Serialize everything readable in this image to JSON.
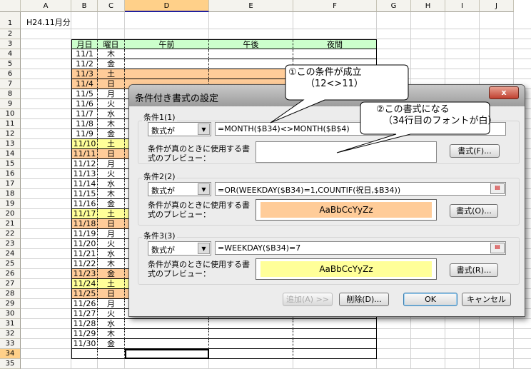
{
  "columns": [
    "A",
    "B",
    "C",
    "D",
    "E",
    "F",
    "G",
    "H",
    "I",
    "J"
  ],
  "selected_column": "D",
  "selected_row": 34,
  "title_cell": "H24.11月分",
  "table_headers": [
    "月日",
    "曜日",
    "午前",
    "午後",
    "夜間"
  ],
  "colors": {
    "header_green": "#CCFFCC",
    "holiday_orange": "#FFCC99",
    "saturday_yellow": "#FFFF99"
  },
  "rows": [
    {
      "date": "11/1",
      "dow": "木",
      "fill": ""
    },
    {
      "date": "11/2",
      "dow": "金",
      "fill": ""
    },
    {
      "date": "11/3",
      "dow": "土",
      "fill": "orange"
    },
    {
      "date": "11/4",
      "dow": "日",
      "fill": "orange"
    },
    {
      "date": "11/5",
      "dow": "月",
      "fill": ""
    },
    {
      "date": "11/6",
      "dow": "火",
      "fill": ""
    },
    {
      "date": "11/7",
      "dow": "水",
      "fill": ""
    },
    {
      "date": "11/8",
      "dow": "木",
      "fill": ""
    },
    {
      "date": "11/9",
      "dow": "金",
      "fill": ""
    },
    {
      "date": "11/10",
      "dow": "土",
      "fill": "yellow"
    },
    {
      "date": "11/11",
      "dow": "日",
      "fill": "orange"
    },
    {
      "date": "11/12",
      "dow": "月",
      "fill": ""
    },
    {
      "date": "11/13",
      "dow": "火",
      "fill": ""
    },
    {
      "date": "11/14",
      "dow": "水",
      "fill": ""
    },
    {
      "date": "11/15",
      "dow": "木",
      "fill": ""
    },
    {
      "date": "11/16",
      "dow": "金",
      "fill": ""
    },
    {
      "date": "11/17",
      "dow": "土",
      "fill": "yellow"
    },
    {
      "date": "11/18",
      "dow": "日",
      "fill": "orange"
    },
    {
      "date": "11/19",
      "dow": "月",
      "fill": ""
    },
    {
      "date": "11/20",
      "dow": "火",
      "fill": ""
    },
    {
      "date": "11/21",
      "dow": "水",
      "fill": ""
    },
    {
      "date": "11/22",
      "dow": "木",
      "fill": ""
    },
    {
      "date": "11/23",
      "dow": "金",
      "fill": "orange"
    },
    {
      "date": "11/24",
      "dow": "土",
      "fill": "yellow"
    },
    {
      "date": "11/25",
      "dow": "日",
      "fill": "orange"
    },
    {
      "date": "11/26",
      "dow": "月",
      "fill": ""
    },
    {
      "date": "11/27",
      "dow": "火",
      "fill": ""
    },
    {
      "date": "11/28",
      "dow": "水",
      "fill": ""
    },
    {
      "date": "11/29",
      "dow": "木",
      "fill": ""
    },
    {
      "date": "11/30",
      "dow": "金",
      "fill": ""
    }
  ],
  "dialog": {
    "title": "条件付き書式の設定",
    "close": "x",
    "preview_label": "条件が真のときに使用する書式のプレビュー：",
    "conditions": [
      {
        "label": "条件1(1)",
        "type": "数式が",
        "formula": "=MONTH($B34)<>MONTH($B$4)",
        "preview": "",
        "format_button": "書式(F)..."
      },
      {
        "label": "条件2(2)",
        "type": "数式が",
        "formula": "=OR(WEEKDAY($B34)=1,COUNTIF(祝日,$B34))",
        "preview": "AaBbCcYyZz",
        "format_button": "書式(O)..."
      },
      {
        "label": "条件3(3)",
        "type": "数式が",
        "formula": "=WEEKDAY($B34)=7",
        "preview": "AaBbCcYyZz",
        "format_button": "書式(R)..."
      }
    ],
    "add_button": "追加(A) >>",
    "delete_button": "削除(D)...",
    "ok_button": "OK",
    "cancel_button": "キャンセル"
  },
  "callouts": [
    {
      "line1": "①この条件が成立",
      "line2": "（12<>11）"
    },
    {
      "line1": "②この書式になる",
      "line2": "（34行目のフォントが白）"
    }
  ]
}
